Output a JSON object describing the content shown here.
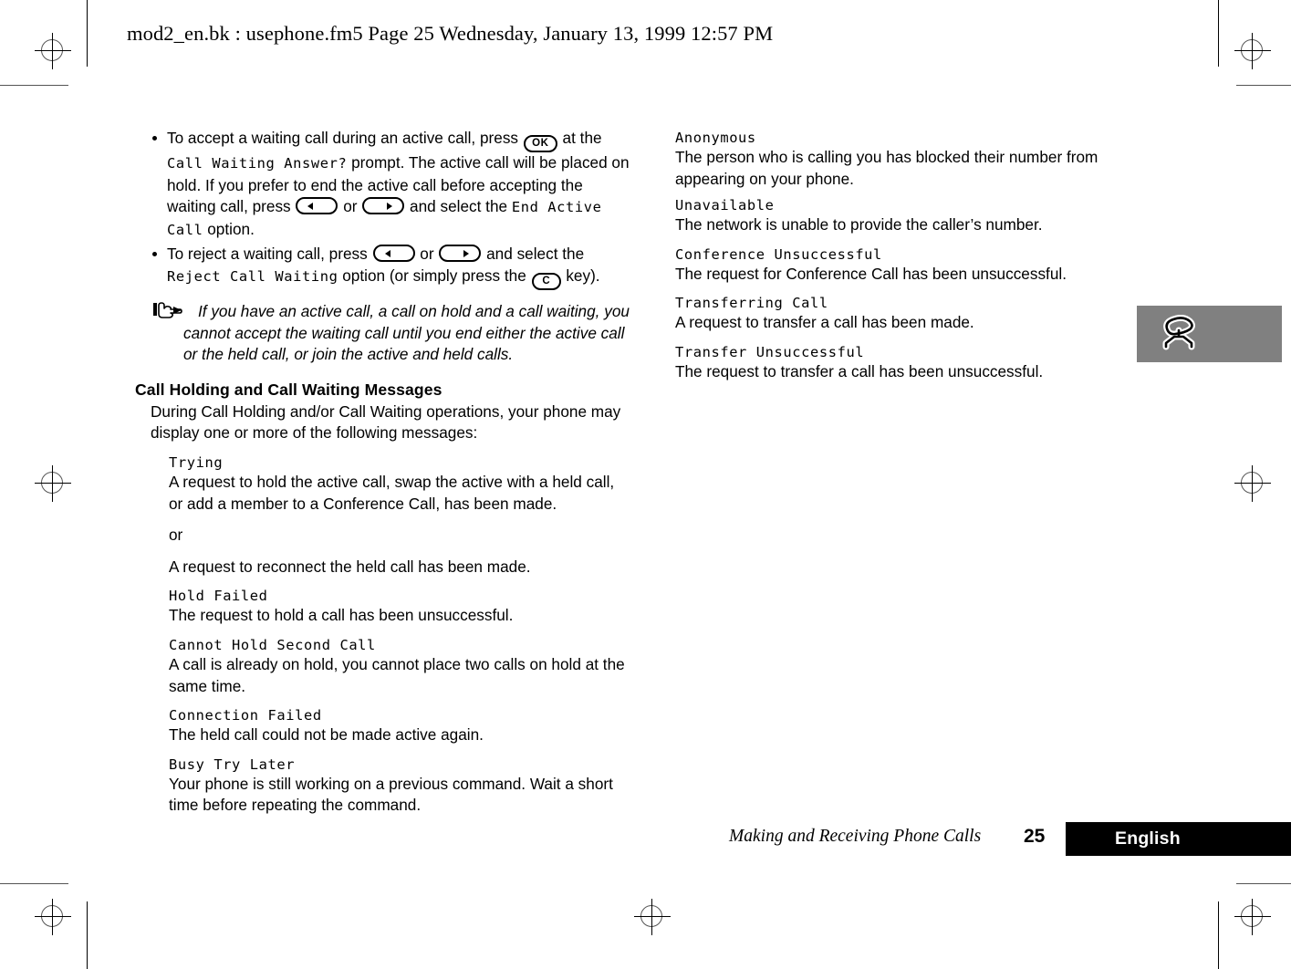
{
  "page_header": {
    "text": "mod2_en.bk : usephone.fm5  Page 25  Wednesday, January 13, 1999  12:57 PM"
  },
  "left_column": {
    "bullets": [
      {
        "id": "accept-waiting-call",
        "segments": [
          {
            "type": "text",
            "value": "To accept a waiting call during an active call, press "
          },
          {
            "type": "key",
            "value": "OK"
          },
          {
            "type": "text",
            "value": " at the "
          },
          {
            "type": "mono",
            "value": "Call Waiting Answer?"
          },
          {
            "type": "text",
            "value": " prompt. The active call will be placed on hold. If you prefer to end the active call before accepting the waiting call, press "
          },
          {
            "type": "key",
            "value": "left-arrow"
          },
          {
            "type": "text",
            "value": " or "
          },
          {
            "type": "key",
            "value": "right-arrow"
          },
          {
            "type": "text",
            "value": " and select the "
          },
          {
            "type": "mono",
            "value": "End Active Call"
          },
          {
            "type": "text",
            "value": " option."
          }
        ],
        "plain": "To accept a waiting call during an active call, press OK at the Call Waiting Answer? prompt. The active call will be placed on hold. If you prefer to end the active call before accepting the waiting call, press left or right and select the End Active Call option."
      },
      {
        "id": "reject-waiting-call",
        "segments": [
          {
            "type": "text",
            "value": "To reject a waiting call, press "
          },
          {
            "type": "key",
            "value": "left-arrow"
          },
          {
            "type": "text",
            "value": " or "
          },
          {
            "type": "key",
            "value": "right-arrow"
          },
          {
            "type": "text",
            "value": " and select the "
          },
          {
            "type": "mono",
            "value": "Reject Call Waiting"
          },
          {
            "type": "text",
            "value": " option (or simply press the "
          },
          {
            "type": "key",
            "value": "C"
          },
          {
            "type": "text",
            "value": " key)."
          }
        ],
        "plain": "To reject a waiting call, press left or right and select the Reject Call Waiting option (or simply press the C key)."
      }
    ],
    "bullet1": {
      "t1": "To accept a waiting call during an active call, press ",
      "t2": " at the ",
      "mono1": "Call Waiting Answer?",
      "t3": " prompt. The active call will be placed on hold. If you prefer to end the active call before accepting the waiting call, press ",
      "t4": " or ",
      "t5": " and select the ",
      "mono2": "End Active Call",
      "t6": " option."
    },
    "bullet2": {
      "t1": "To reject a waiting call, press ",
      "t2": " or ",
      "t3": " and select the ",
      "mono1": "Reject Call Waiting",
      "t4": " option (or simply press the ",
      "t5": " key)."
    },
    "note": "If you have an active call, a call on hold and a call waiting, you cannot accept the waiting call until you end either the active call or the held call, or join the active and held calls.",
    "heading": "Call Holding and Call Waiting Messages",
    "intro": "During Call Holding and/or Call Waiting operations, your phone may display one or more of the following messages:",
    "messages": [
      {
        "title": "Trying",
        "desc": "A request to hold the active call, swap the active with a held call, or add a member to a Conference Call, has been made.",
        "or_label": "or",
        "desc2": "A request to reconnect the held call has been made."
      },
      {
        "title": "Hold Failed",
        "desc": "The request to hold a call has been unsuccessful."
      },
      {
        "title": "Cannot Hold Second Call",
        "desc": "A call is already on hold, you cannot place two calls on hold at the same time."
      },
      {
        "title": "Connection Failed",
        "desc": "The held call could not be made active again."
      },
      {
        "title": "Busy Try Later",
        "desc": "Your phone is still working on a previous command. Wait a short time before repeating the command."
      }
    ]
  },
  "right_column": {
    "messages": [
      {
        "title": "Anonymous",
        "desc": "The person who is calling you has blocked their number from appearing on your phone."
      },
      {
        "title": "Unavailable",
        "desc": "The network is unable to provide the caller’s number."
      },
      {
        "title": "Conference Unsuccessful",
        "desc": "The request for Conference Call has been unsuccessful."
      },
      {
        "title": "Transferring Call",
        "desc": "A request to transfer a call has been made."
      },
      {
        "title": "Transfer Unsuccessful",
        "desc": "The request to transfer a call has been unsuccessful."
      }
    ]
  },
  "thumb_tab": {
    "icon": "phone-handset-icon",
    "background": "#808080"
  },
  "footer": {
    "running_head": "Making and Receiving Phone Calls",
    "page_number": "25",
    "language": "English",
    "bar_color": "#000000"
  },
  "keys": {
    "ok_label": "OK",
    "c_label": "C"
  }
}
